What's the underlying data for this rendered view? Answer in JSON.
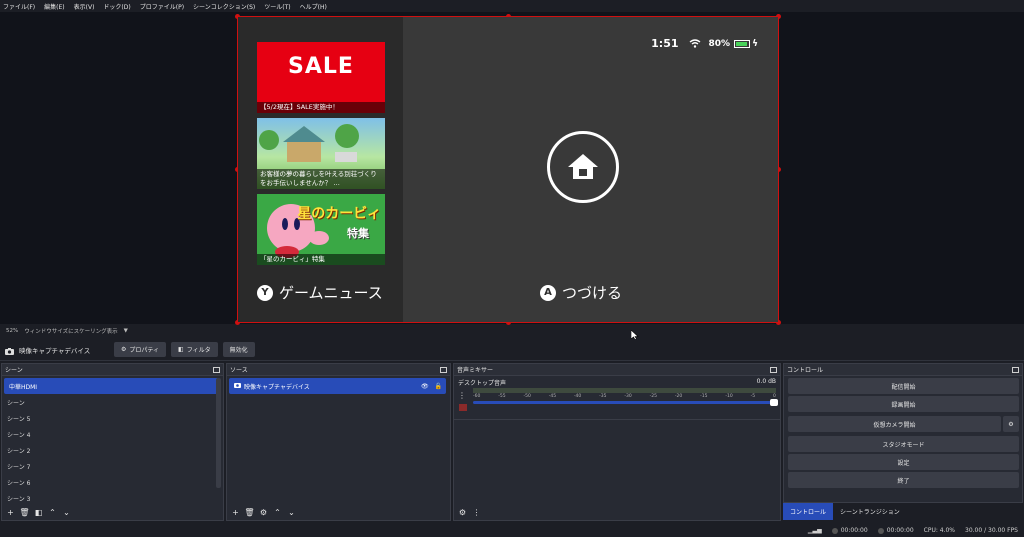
{
  "menu": [
    "ファイル(F)",
    "編集(E)",
    "表示(V)",
    "ドック(D)",
    "プロファイル(P)",
    "シーンコレクション(S)",
    "ツール(T)",
    "ヘルプ(H)"
  ],
  "preview": {
    "status": {
      "time": "1:51",
      "battery_pct": "80%"
    },
    "tiles": [
      {
        "big_text": "SALE",
        "caption": "【5/2現在】SALE実施中！"
      },
      {
        "caption": "お客様の夢の暮らしを叶える別荘づくりをお手伝いしませんか？ …"
      },
      {
        "title": "星のカービィ",
        "sub": "特集",
        "caption": "「星のカービィ」特集"
      }
    ],
    "y_button": "Y",
    "y_label": "ゲームニュース",
    "a_button": "A",
    "a_label": "つづける"
  },
  "scale": {
    "percent": "52%",
    "mode": "ウィンドウサイズにスケーリング表示",
    "caret": "▼"
  },
  "source_toolbar": {
    "name": "映像キャプチャデバイス",
    "properties": "プロパティ",
    "filters": "フィルタ",
    "disable": "無効化"
  },
  "scenes": {
    "title": "シーン",
    "items": [
      "中華HDMI",
      "シーン",
      "シーン 5",
      "シーン 4",
      "シーン 2",
      "シーン 7",
      "シーン 6",
      "シーン 3"
    ]
  },
  "sources": {
    "title": "ソース",
    "items": [
      "映像キャプチャデバイス"
    ]
  },
  "mixer": {
    "title": "音声ミキサー",
    "channel": "デスクトップ音声",
    "level": "0.0 dB",
    "ticks": [
      "-60",
      "-55",
      "-50",
      "-45",
      "-40",
      "-35",
      "-30",
      "-25",
      "-20",
      "-15",
      "-10",
      "-5",
      "0"
    ],
    "volume": 1.0
  },
  "controls": {
    "title": "コントロール",
    "buttons": [
      "配信開始",
      "録画開始",
      "仮想カメラ開始",
      "スタジオモード",
      "設定",
      "終了"
    ]
  },
  "tabs": [
    "コントロール",
    "シーントランジション"
  ],
  "statusbar": {
    "stream_time": "00:00:00",
    "rec_time": "00:00:00",
    "cpu": "CPU: 4.0%",
    "fps": "30.00 / 30.00 FPS"
  },
  "colors": {
    "accent": "#284cb8",
    "selection_outline": "#d01010",
    "sale_red": "#e60012"
  }
}
